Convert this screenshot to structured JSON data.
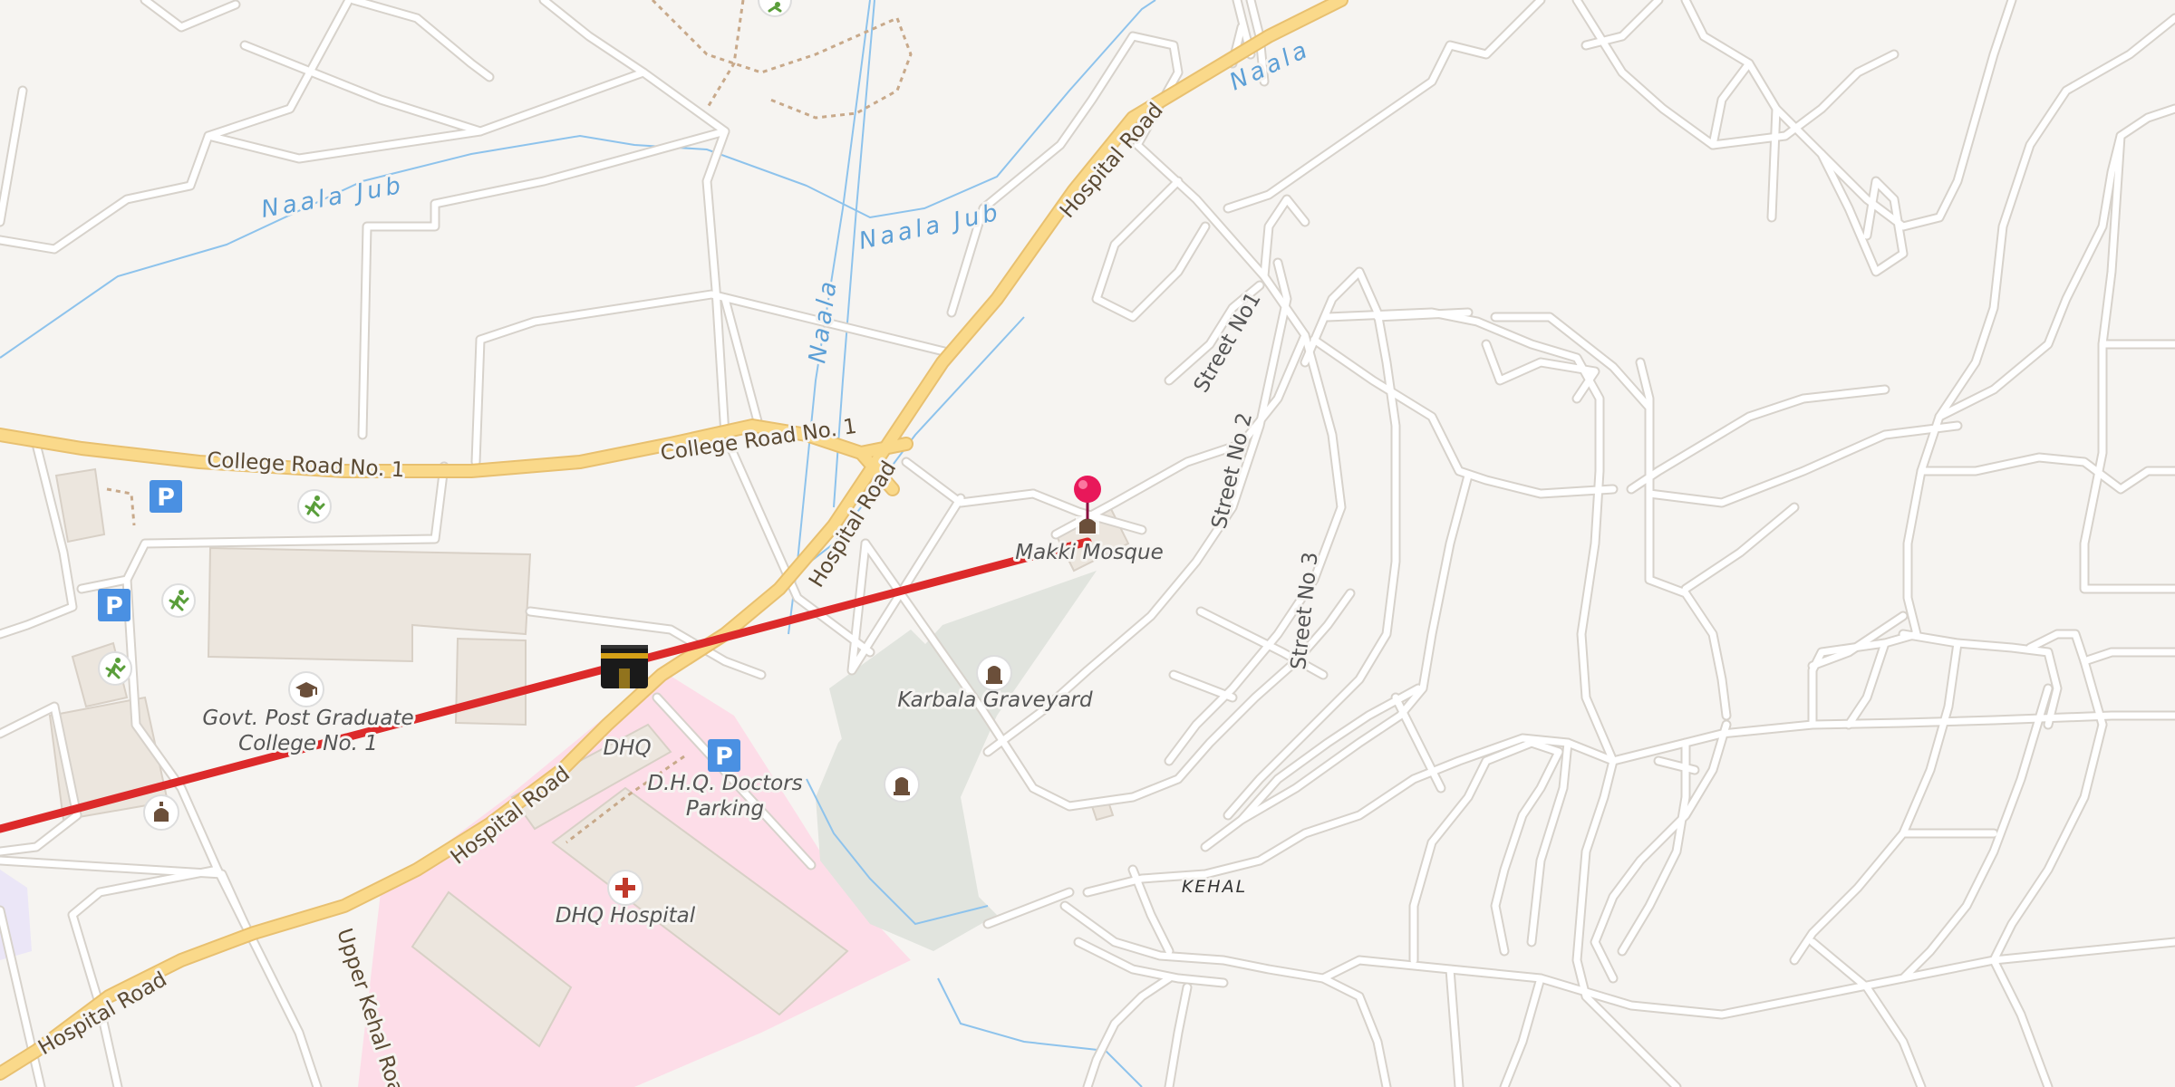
{
  "map": {
    "roads": {
      "hospital_road": "Hospital Road",
      "college_road_1": "College Road No. 1",
      "college_road_2": "College Road No. 1",
      "upper_kehal": "Upper Kehal Road",
      "street_1": "Street No1",
      "street_2": "Street No 2",
      "street_3": "Street No 3"
    },
    "waterways": {
      "naala_jub_1": "Naala Jub",
      "naala_jub_2": "Naala Jub",
      "naala_1": "Naala",
      "naala_2": "Naala"
    },
    "places": {
      "makki_mosque": "Makki Mosque",
      "karbala_graveyard": "Karbala Graveyard",
      "govt_college_line1": "Govt. Post Graduate",
      "govt_college_line2": "College No. 1",
      "dhq": "DHQ",
      "dhq_parking_line1": "D.H.Q. Doctors",
      "dhq_parking_line2": "Parking",
      "dhq_hospital": "DHQ Hospital",
      "kehal": "KEHAL"
    },
    "icons": {
      "parking": "P",
      "pin": "map-pin-icon",
      "kaaba": "kaaba-icon",
      "hospital": "hospital-cross-icon",
      "school": "graduation-cap-icon",
      "sport": "running-person-icon",
      "graveyard": "grave-icon"
    },
    "colors": {
      "background": "#f6f4f1",
      "major_road": "#fad98a",
      "minor_road": "#ffffff",
      "hospital_area": "#fddde8",
      "graveyard_area": "#e1e4de",
      "water": "#8ec3ec",
      "route": "#dc2a2a",
      "pin": "#e8185a",
      "parking": "#4a90e2"
    }
  }
}
